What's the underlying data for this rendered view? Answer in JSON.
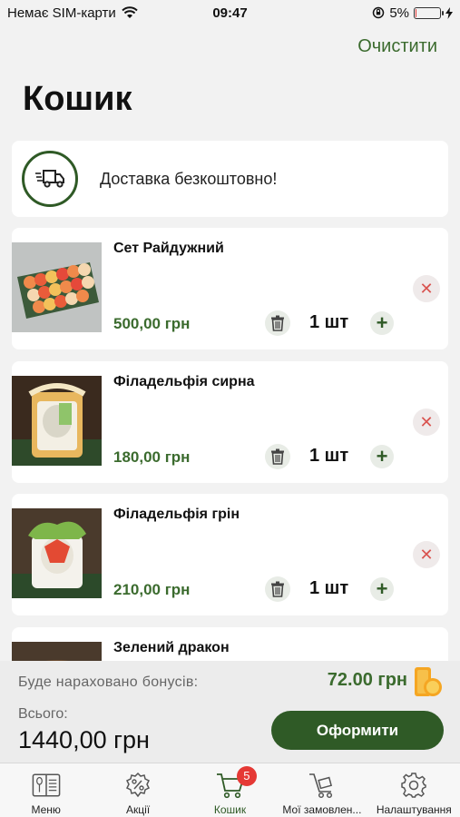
{
  "status_bar": {
    "carrier": "Немає SIM-карти",
    "time": "09:47",
    "battery": "5%"
  },
  "header": {
    "clear_label": "Очистити",
    "title": "Кошик"
  },
  "delivery": {
    "text": "Доставка безкоштовно!",
    "icon": "truck-icon"
  },
  "cart_items": [
    {
      "name": "Сет Райдужний",
      "price": "500,00 грн",
      "qty": "1 шт"
    },
    {
      "name": "Філадельфія сирна",
      "price": "180,00 грн",
      "qty": "1 шт"
    },
    {
      "name": "Філадельфія грін",
      "price": "210,00 грн",
      "qty": "1 шт"
    },
    {
      "name": "Зелений дракон",
      "price": "",
      "qty": ""
    }
  ],
  "summary": {
    "bonus_label": "Буде нараховано бонусів:",
    "bonus_value": "72.00 грн",
    "total_label": "Всього:",
    "total_value": "1440,00 грн",
    "checkout_label": "Оформити"
  },
  "tabbar": {
    "tabs": [
      {
        "label": "Меню",
        "icon": "menu-book-icon"
      },
      {
        "label": "Акції",
        "icon": "discount-icon"
      },
      {
        "label": "Кошик",
        "icon": "cart-icon",
        "badge": "5"
      },
      {
        "label": "Мої замовлен...",
        "icon": "orders-icon"
      },
      {
        "label": "Налаштування",
        "icon": "gear-icon"
      }
    ]
  },
  "colors": {
    "accent": "#2f5a26",
    "price": "#3b6b2e",
    "badge": "#e53935"
  }
}
